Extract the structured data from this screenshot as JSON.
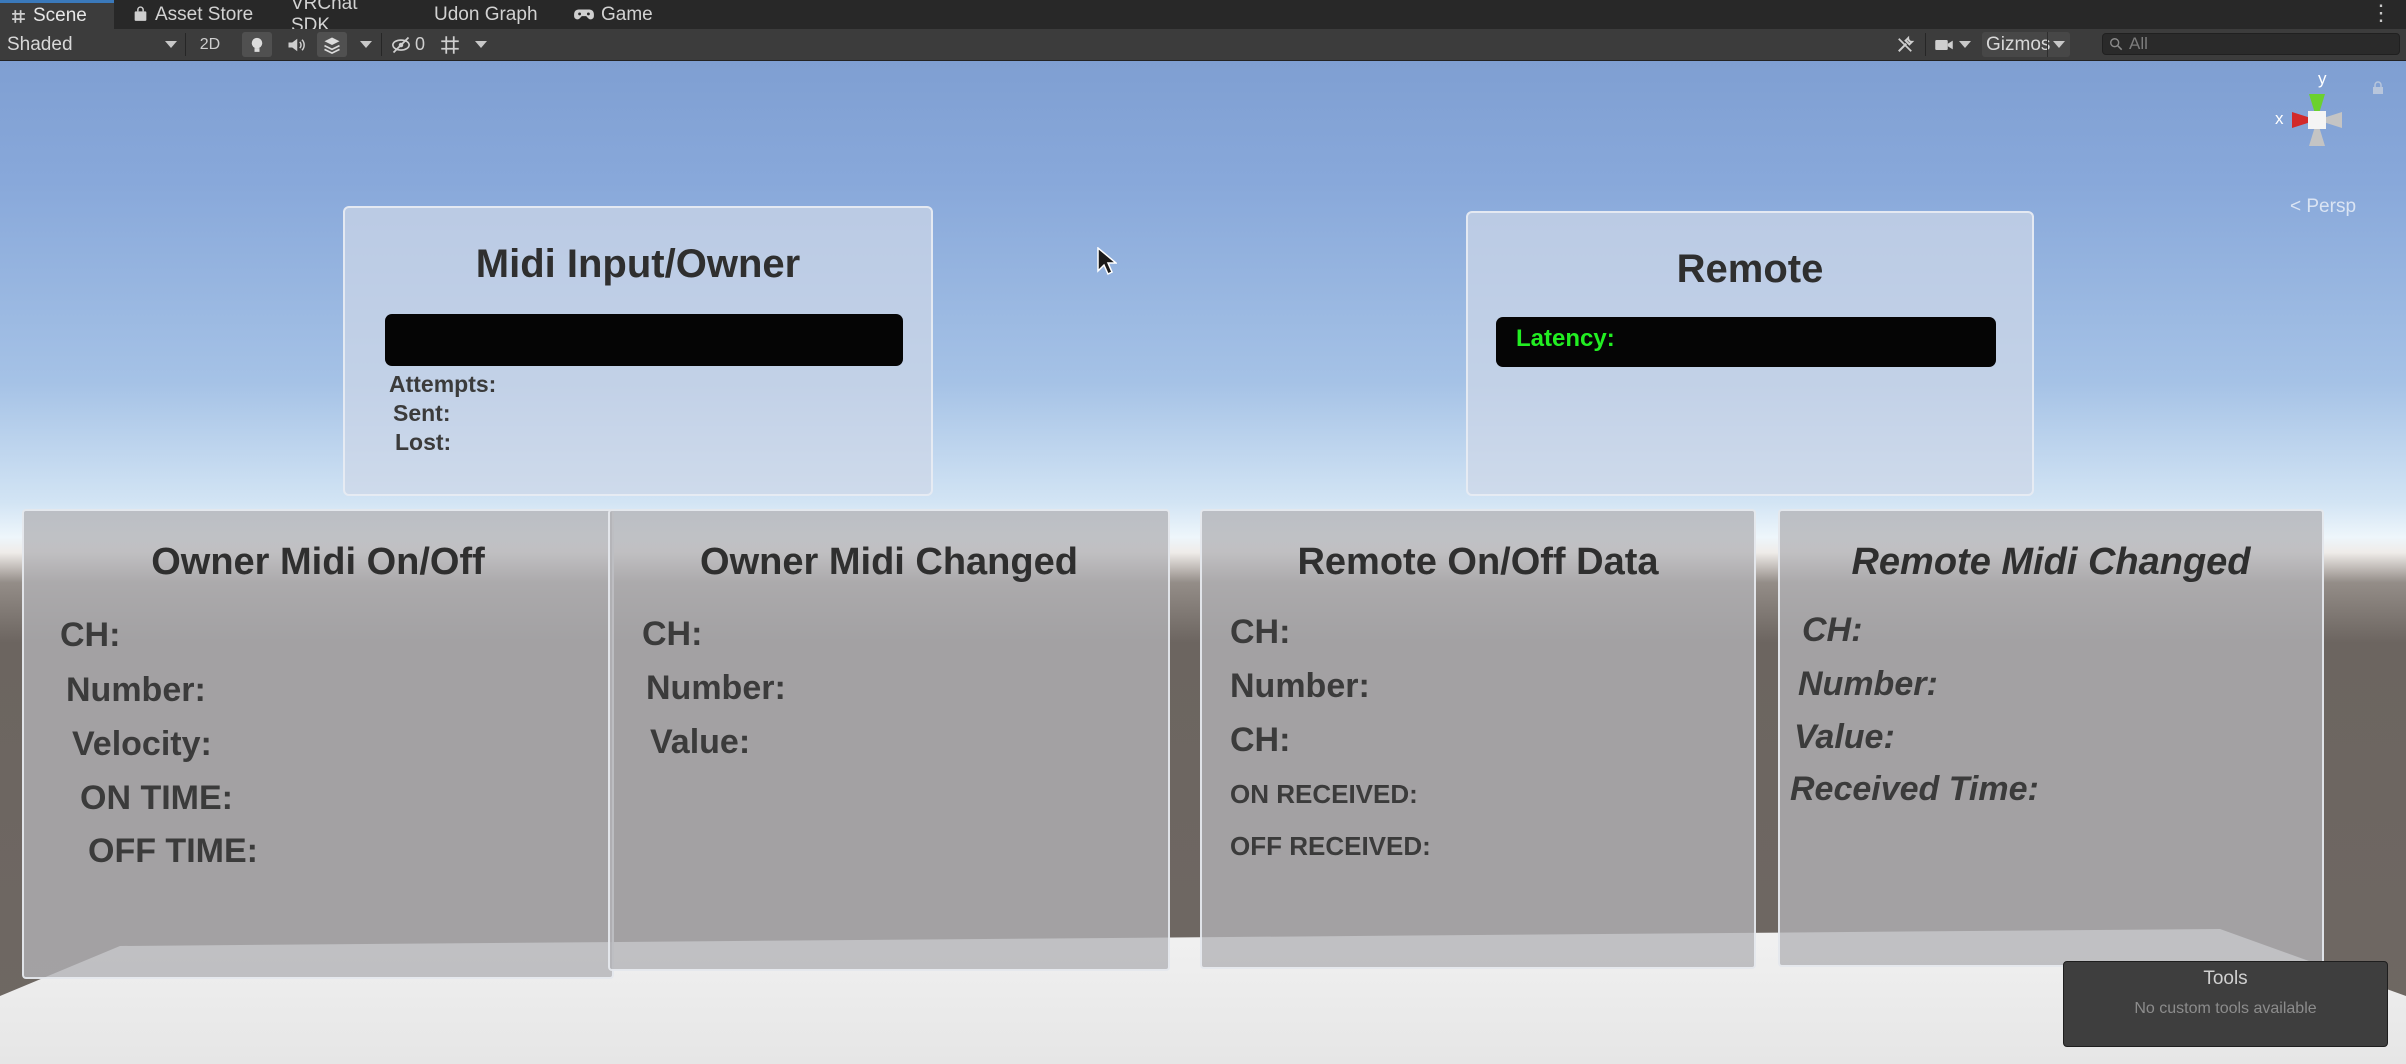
{
  "tabs": [
    {
      "label": "Scene",
      "icon": "hash-icon"
    },
    {
      "label": "Asset Store",
      "icon": "shopping-bag-icon"
    },
    {
      "label": "VRChat SDK",
      "icon": ""
    },
    {
      "label": "Udon Graph",
      "icon": ""
    },
    {
      "label": "Game",
      "icon": "gamepad-icon"
    }
  ],
  "toolbar": {
    "shading_mode": "Shaded",
    "mode_2d": "2D",
    "hidden_count": "0",
    "gizmos": "Gizmos",
    "search_placeholder": "All"
  },
  "gizmo": {
    "x_label": "x",
    "y_label": "y",
    "projection": "< Persp"
  },
  "panels": {
    "midi_input": {
      "title": "Midi Input/Owner",
      "labels": [
        "Attempts:",
        "Sent:",
        "Lost:"
      ]
    },
    "remote": {
      "title": "Remote",
      "latency_label": "Latency:"
    },
    "owner_on_off": {
      "title": "Owner Midi On/Off",
      "labels": [
        "CH:",
        "Number:",
        "Velocity:",
        "ON TIME:",
        "OFF TIME:"
      ]
    },
    "owner_changed": {
      "title": "Owner Midi Changed",
      "labels": [
        "CH:",
        "Number:",
        "Value:"
      ]
    },
    "remote_on_off": {
      "title": "Remote On/Off Data",
      "labels": [
        "CH:",
        "Number:",
        "CH:",
        "ON RECEIVED:",
        "OFF RECEIVED:"
      ]
    },
    "remote_changed": {
      "title": "Remote Midi Changed",
      "labels": [
        "CH:",
        "Number:",
        "Value:",
        "Received Time:"
      ]
    }
  },
  "tools_overlay": {
    "title": "Tools",
    "subtitle": "No custom tools available"
  },
  "colors": {
    "tab_accent": "#3a79bb",
    "latency_text": "#22ee22",
    "sky": "#88a8da"
  }
}
